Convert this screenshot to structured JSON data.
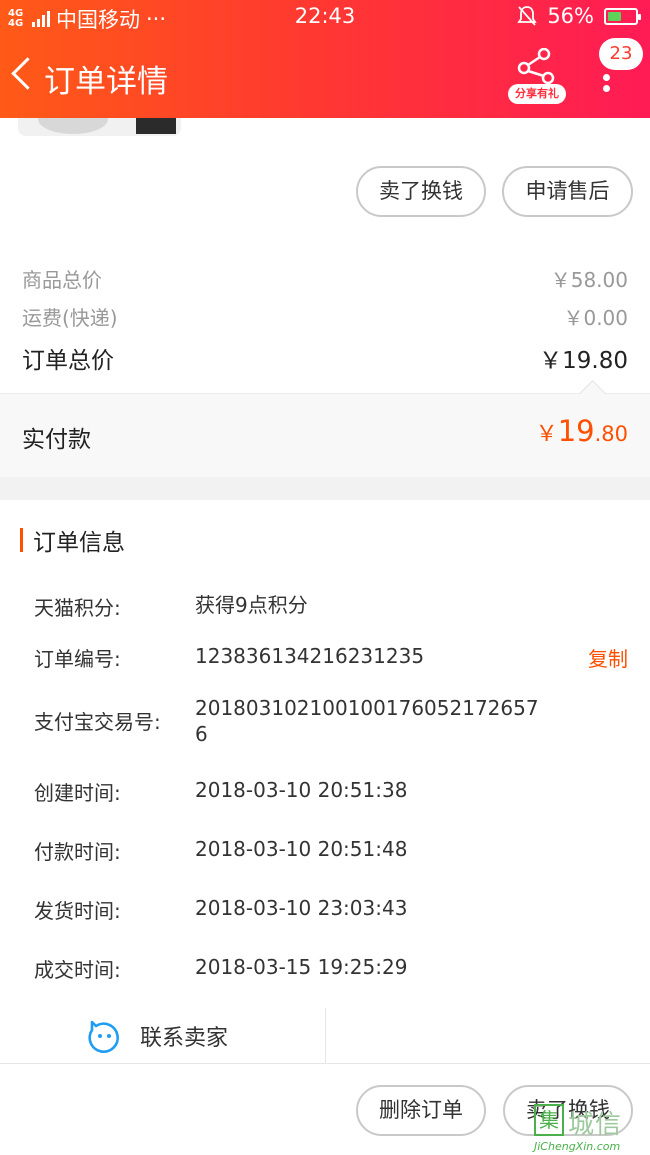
{
  "status_bar": {
    "network_type": "4G 4G",
    "carrier": "中国移动",
    "more": "···",
    "time": "22:43",
    "battery_percent": "56%",
    "battery_level": 0.56
  },
  "nav": {
    "title": "订单详情",
    "share_label": "分享有礼",
    "badge_count": "23"
  },
  "actions_top": {
    "sell_label": "卖了换钱",
    "after_sale_label": "申请售后"
  },
  "prices": {
    "goods_total_label": "商品总价",
    "goods_total_value": "￥58.00",
    "shipping_label": "运费(快递)",
    "shipping_value": "￥0.00",
    "order_total_label": "订单总价",
    "order_total_value": "￥19.80",
    "paid_label": "实付款",
    "paid_symbol": "￥",
    "paid_int": "19",
    "paid_dec": ".80"
  },
  "order_info": {
    "title": "订单信息",
    "rows": [
      {
        "label": "天猫积分:",
        "value": "获得9点积分"
      },
      {
        "label": "订单编号:",
        "value": "123836134216231235"
      },
      {
        "label": "支付宝交易号:",
        "value": "2018031021001001760521726576"
      },
      {
        "label": "创建时间:",
        "value": "2018-03-10 20:51:38"
      },
      {
        "label": "付款时间:",
        "value": "2018-03-10 20:51:48"
      },
      {
        "label": "发货时间:",
        "value": "2018-03-10 23:03:43"
      },
      {
        "label": "成交时间:",
        "value": "2018-03-15 19:25:29"
      }
    ],
    "copy_label": "复制"
  },
  "contact": {
    "label": "联系卖家"
  },
  "bottom": {
    "delete_label": "删除订单",
    "sell_label": "卖了换钱"
  },
  "watermark": {
    "box_char": "集",
    "cn": "城信",
    "en": "JiChengXin.com"
  },
  "colors": {
    "accent": "#ff5000",
    "header_start": "#ff5a17",
    "header_end": "#ff1b55"
  }
}
